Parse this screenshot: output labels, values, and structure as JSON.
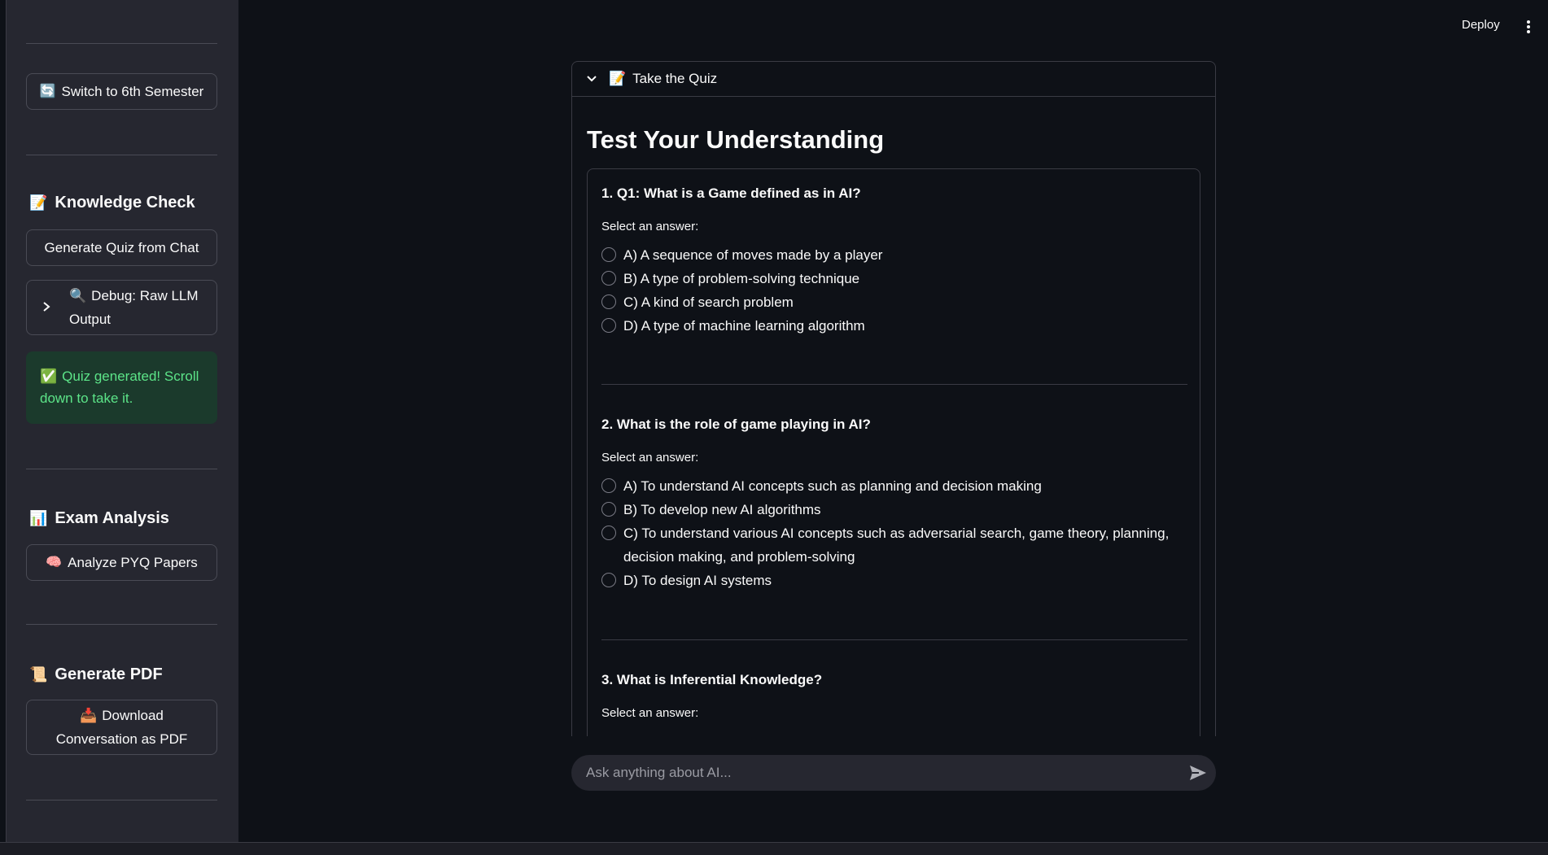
{
  "sidebar": {
    "switch_semester": {
      "emoji": "🔄",
      "label": "Switch to 6th Semester"
    },
    "knowledge_check": {
      "heading": "Knowledge Check",
      "heading_emoji": "📝",
      "generate_quiz": "Generate Quiz from Chat",
      "debug_expander": {
        "emoji": "🔍",
        "label": "Debug: Raw LLM Output"
      },
      "success": {
        "emoji": "✅",
        "message": "Quiz generated! Scroll down to take it."
      }
    },
    "exam_analysis": {
      "heading": "Exam Analysis",
      "heading_emoji": "📊",
      "analyze": {
        "emoji": "🧠",
        "label": "Analyze PYQ Papers"
      }
    },
    "generate_pdf": {
      "heading": "Generate PDF",
      "heading_emoji": "📜",
      "download": {
        "emoji": "📥",
        "label": "Download Conversation as PDF"
      }
    }
  },
  "header": {
    "deploy_label": "Deploy"
  },
  "quiz": {
    "expander_label": "Take the Quiz",
    "expander_emoji": "📝",
    "title": "Test Your Understanding",
    "select_prompt": "Select an answer:",
    "questions": [
      {
        "text": "1. Q1: What is a Game defined as in AI?",
        "options": [
          "A) A sequence of moves made by a player",
          "B) A type of problem-solving technique",
          "C) A kind of search problem",
          "D) A type of machine learning algorithm"
        ]
      },
      {
        "text": "2. What is the role of game playing in AI?",
        "options": [
          "A) To understand AI concepts such as planning and decision making",
          "B) To develop new AI algorithms",
          "C) To understand various AI concepts such as adversarial search, game theory, planning, decision making, and problem-solving",
          "D) To design AI systems"
        ]
      },
      {
        "text": "3. What is Inferential Knowledge?",
        "options": []
      }
    ]
  },
  "chat": {
    "placeholder": "Ask anything about AI..."
  },
  "colors": {
    "background": "#0e1117",
    "sidebar": "#262730",
    "success_bg": "#1b3a2c",
    "success_text": "#5ce488"
  }
}
